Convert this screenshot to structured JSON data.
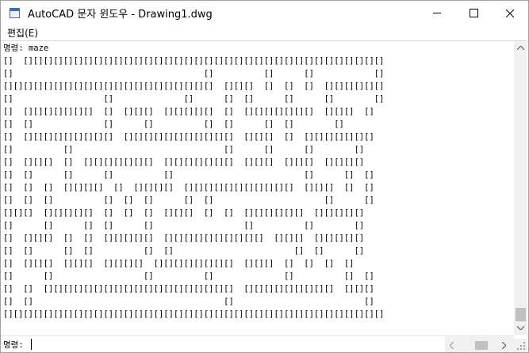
{
  "window": {
    "title": "AutoCAD 문자 윈도우 - Drawing1.dwg"
  },
  "menu": {
    "edit_label": "편집(E)"
  },
  "command_history": {
    "lines": [
      "명령: maze",
      "[]  [][][][][][][][][][][][][][][][][][][][][][][][][][][][][][][][][][][][]",
      "[]                                      []          []      []            []",
      "[][][][][][][][][][][][][][][][][][][][][]  [][][]  []  []  []  [][][][][][]",
      "[]                  []              []      []  []      []      []        []",
      "[]  [][][][][][][]  []  [][][]  [][][][][]  []  [][][][][][][]  [][][]  []",
      "[]  []              []      []          []  []      []  []        []",
      "[]  [][][][][][][][][]  [][][][][][][][][][][]  [][][]  []  [][][][][][][]",
      "[]          []                              []      []      []        []",
      "[]  [][][]  []  [][][][][][][]  [][][][][][][]  [][][]  [][][]  [][][][]",
      "[]  []      []      []          []                          []      []  []",
      "[]  []  []  [][][][]  []  [][][][]  [][][][][][][][][][][]  [][][]  []  []",
      "[]  []  []          []  []  []      []  []                      []      []",
      "[][][]  [][][][][]  []  []  []  [][][]  []  []  [][][][][][]  [][][][][]",
      "[]      []      []  []      []                  []          []        []",
      "[]  [][][]  []  []  [][][][][]  [][][][][][][][][][]  [][][]  [][][][][]",
      "[]  []      []  []          []  []                        []  []      []",
      "[]  [][][]  [][][]  [][][][]  [][][][][][][][]  [][][]  []  []  []  []",
      "[]      []                  []          []              []          []  []",
      "[]  []  [][][][][][][][][][][][][][][][][][][]  [][][][][][][][][]  [][][]",
      "[]  []                                      []                          []",
      "[][][][][][][][][][][][][][][][][][][][][][][][][][][][][][][][][][][][][][]"
    ]
  },
  "command_line": {
    "prompt": "명령:",
    "value": ""
  }
}
